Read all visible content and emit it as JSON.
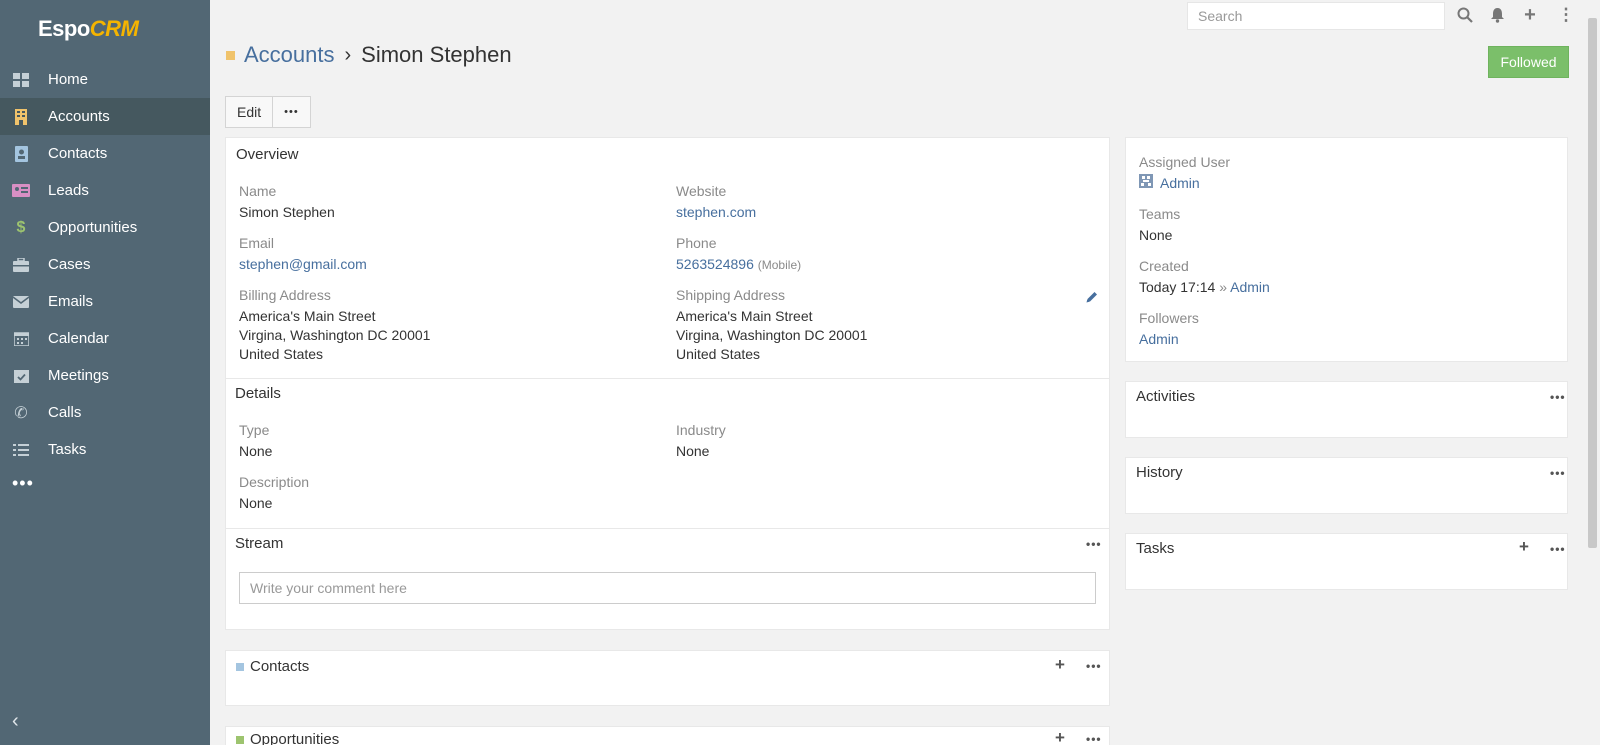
{
  "brand": {
    "logo_main": "Espo",
    "logo_accent": "CRM"
  },
  "sidebar": {
    "items": [
      {
        "label": "Home",
        "icon": "home-icon"
      },
      {
        "label": "Accounts",
        "icon": "building-icon",
        "active": true
      },
      {
        "label": "Contacts",
        "icon": "contact-card-icon"
      },
      {
        "label": "Leads",
        "icon": "id-card-icon"
      },
      {
        "label": "Opportunities",
        "icon": "dollar-icon"
      },
      {
        "label": "Cases",
        "icon": "briefcase-icon"
      },
      {
        "label": "Emails",
        "icon": "envelope-icon"
      },
      {
        "label": "Calendar",
        "icon": "calendar-icon"
      },
      {
        "label": "Meetings",
        "icon": "calendar-check-icon"
      },
      {
        "label": "Calls",
        "icon": "phone-icon"
      },
      {
        "label": "Tasks",
        "icon": "tasks-icon"
      }
    ],
    "more": "•••"
  },
  "topbar": {
    "search_placeholder": "Search"
  },
  "header": {
    "breadcrumb_parent": "Accounts",
    "breadcrumb_separator": "›",
    "record_name": "Simon Stephen",
    "followed_label": "Followed",
    "edit_label": "Edit",
    "more_label": "•••"
  },
  "overview": {
    "title": "Overview",
    "name_label": "Name",
    "name_value": "Simon Stephen",
    "website_label": "Website",
    "website_value": "stephen.com",
    "email_label": "Email",
    "email_value": "stephen@gmail.com",
    "phone_label": "Phone",
    "phone_value": "5263524896",
    "phone_type": "(Mobile)",
    "billing_label": "Billing Address",
    "billing_lines": [
      "America's Main Street",
      "Virgina, Washington DC 20001",
      "United States"
    ],
    "shipping_label": "Shipping Address",
    "shipping_lines": [
      "America's Main Street",
      "Virgina, Washington DC 20001",
      "United States"
    ]
  },
  "details": {
    "title": "Details",
    "type_label": "Type",
    "type_value": "None",
    "industry_label": "Industry",
    "industry_value": "None",
    "description_label": "Description",
    "description_value": "None"
  },
  "stream": {
    "title": "Stream",
    "comment_placeholder": "Write your comment here"
  },
  "contacts_panel": {
    "title": "Contacts",
    "color": "#a4c5e0"
  },
  "opportunities_panel": {
    "title": "Opportunities",
    "color": "#9dc46f"
  },
  "side": {
    "assigned_user_label": "Assigned User",
    "assigned_user_value": "Admin",
    "teams_label": "Teams",
    "teams_value": "None",
    "created_label": "Created",
    "created_date": "Today 17:14",
    "created_sep": "»",
    "created_by": "Admin",
    "followers_label": "Followers",
    "followers_value": "Admin"
  },
  "activities_panel": {
    "title": "Activities"
  },
  "history_panel": {
    "title": "History"
  },
  "tasks_panel": {
    "title": "Tasks"
  },
  "colors": {
    "sidebar": "#526774",
    "sidebar_active": "#45585f",
    "accent_link": "#476f9e",
    "followed": "#7bbf6a",
    "accounts_square": "#f0c36b"
  }
}
